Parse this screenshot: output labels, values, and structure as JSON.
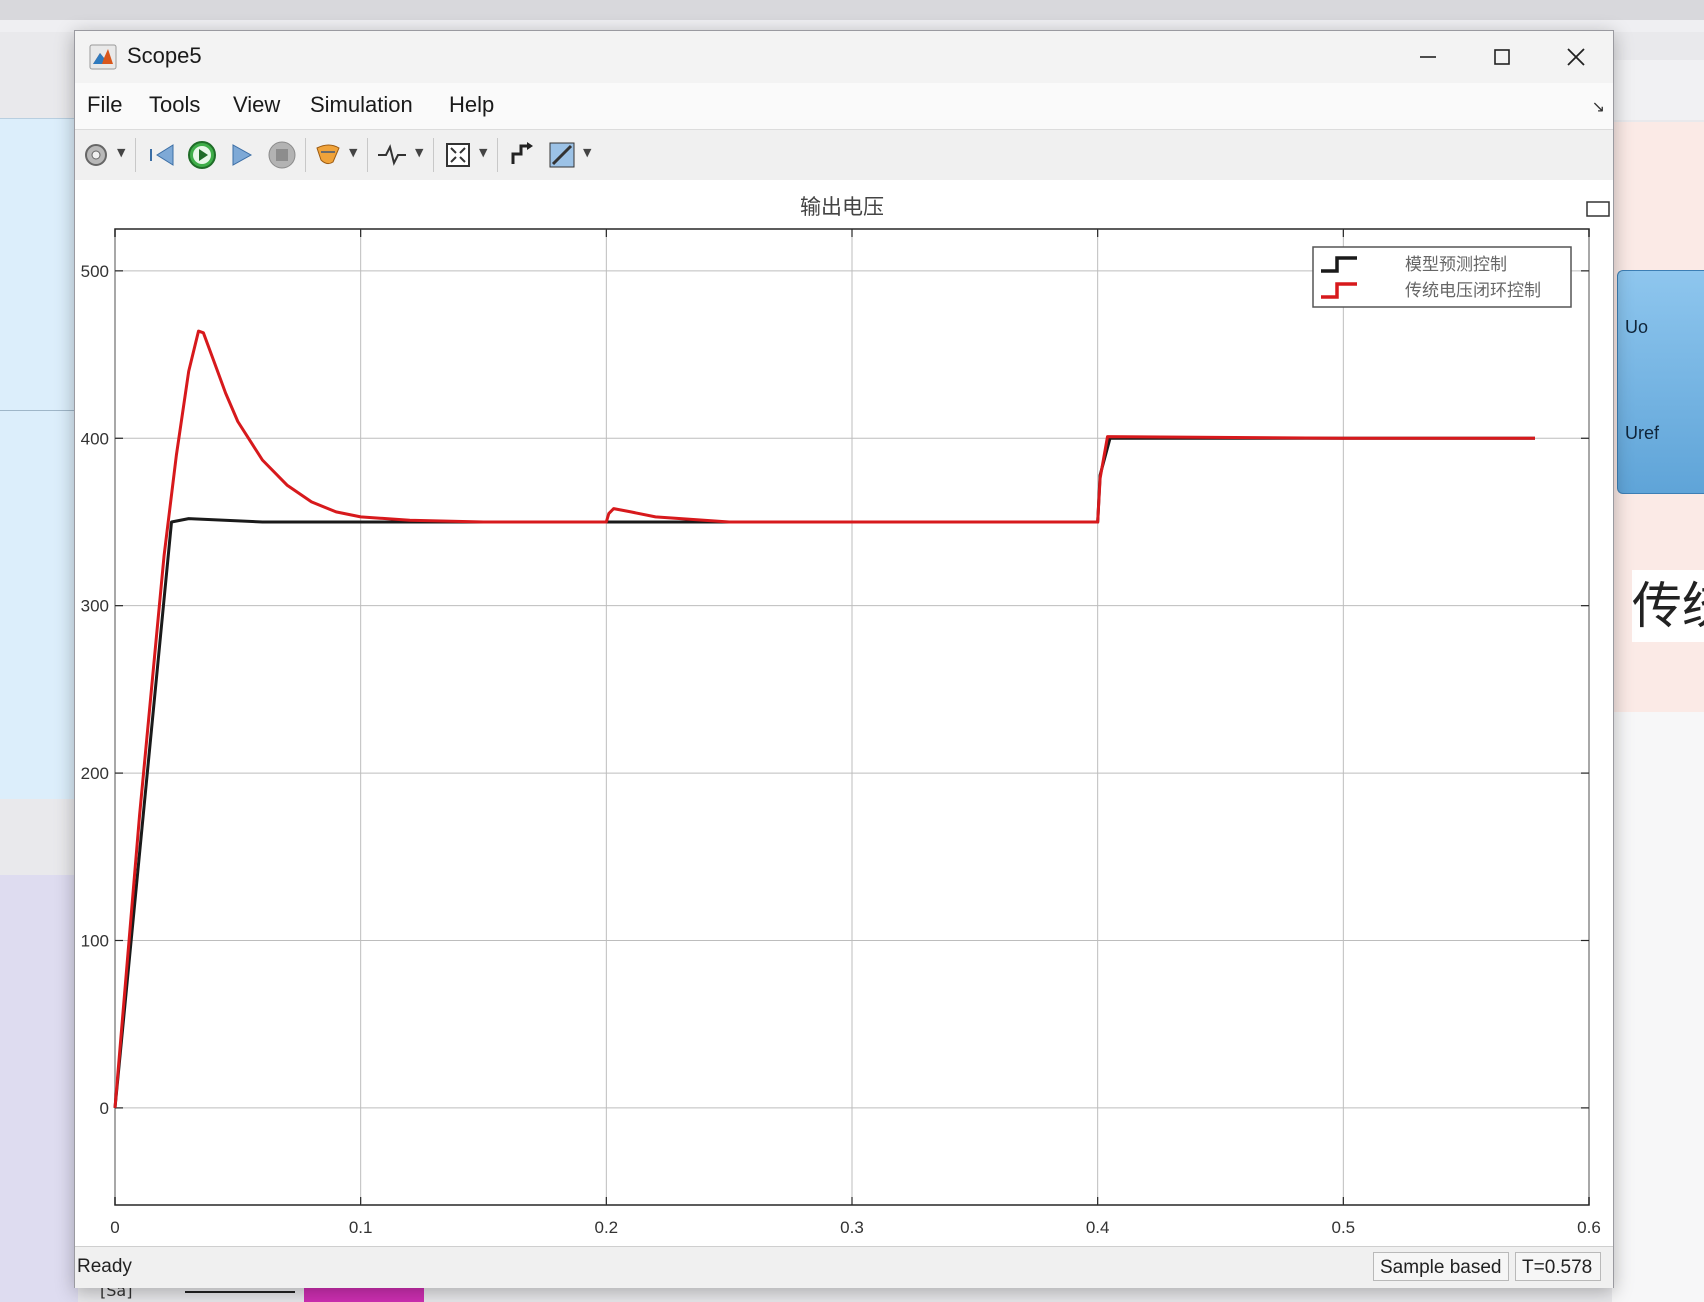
{
  "window": {
    "title": "Scope5"
  },
  "menu": [
    "File",
    "Tools",
    "View",
    "Simulation",
    "Help"
  ],
  "toolbar": {
    "icons": [
      "settings-icon",
      "step-back-icon",
      "run-icon",
      "step-forward-icon",
      "stop-icon",
      "highlight-icon",
      "triggers-icon",
      "zoom-icon",
      "autoscale-icon",
      "style-icon"
    ]
  },
  "status": {
    "ready": "Ready",
    "mode": "Sample based",
    "time": "T=0.578"
  },
  "background": {
    "port_uo": "Uo",
    "port_uref": "Uref",
    "cjk_fragment": "传统",
    "bottom_block_text": "[Sa]"
  },
  "chart_data": {
    "type": "line",
    "title": "输出电压",
    "xlabel": "",
    "ylabel": "",
    "xlim": [
      0,
      0.6
    ],
    "ylim": [
      -58,
      525
    ],
    "xticks": [
      "0",
      "0.1",
      "0.2",
      "0.3",
      "0.4",
      "0.5",
      "0.6"
    ],
    "yticks": [
      "0",
      "100",
      "200",
      "300",
      "400",
      "500"
    ],
    "grid": true,
    "legend": "top-right",
    "series": [
      {
        "name": "模型预测控制",
        "color": "#1a1a1a",
        "x": [
          0,
          0.023,
          0.03,
          0.06,
          0.1,
          0.2,
          0.3,
          0.4,
          0.401,
          0.405,
          0.5,
          0.578
        ],
        "y": [
          0,
          350,
          352,
          350,
          350,
          350,
          350,
          350,
          378,
          400,
          400,
          400
        ]
      },
      {
        "name": "传统电压闭环控制",
        "color": "#d7191c",
        "x": [
          0,
          0.01,
          0.02,
          0.025,
          0.03,
          0.034,
          0.036,
          0.04,
          0.045,
          0.05,
          0.06,
          0.07,
          0.08,
          0.09,
          0.1,
          0.12,
          0.15,
          0.2,
          0.201,
          0.203,
          0.21,
          0.22,
          0.25,
          0.3,
          0.4,
          0.401,
          0.404,
          0.5,
          0.578
        ],
        "y": [
          0,
          175,
          330,
          390,
          440,
          464,
          463,
          447,
          427,
          410,
          387,
          372,
          362,
          356,
          353,
          351,
          350,
          350,
          355,
          358,
          356,
          353,
          350,
          350,
          350,
          376,
          401,
          400,
          400
        ]
      }
    ]
  }
}
